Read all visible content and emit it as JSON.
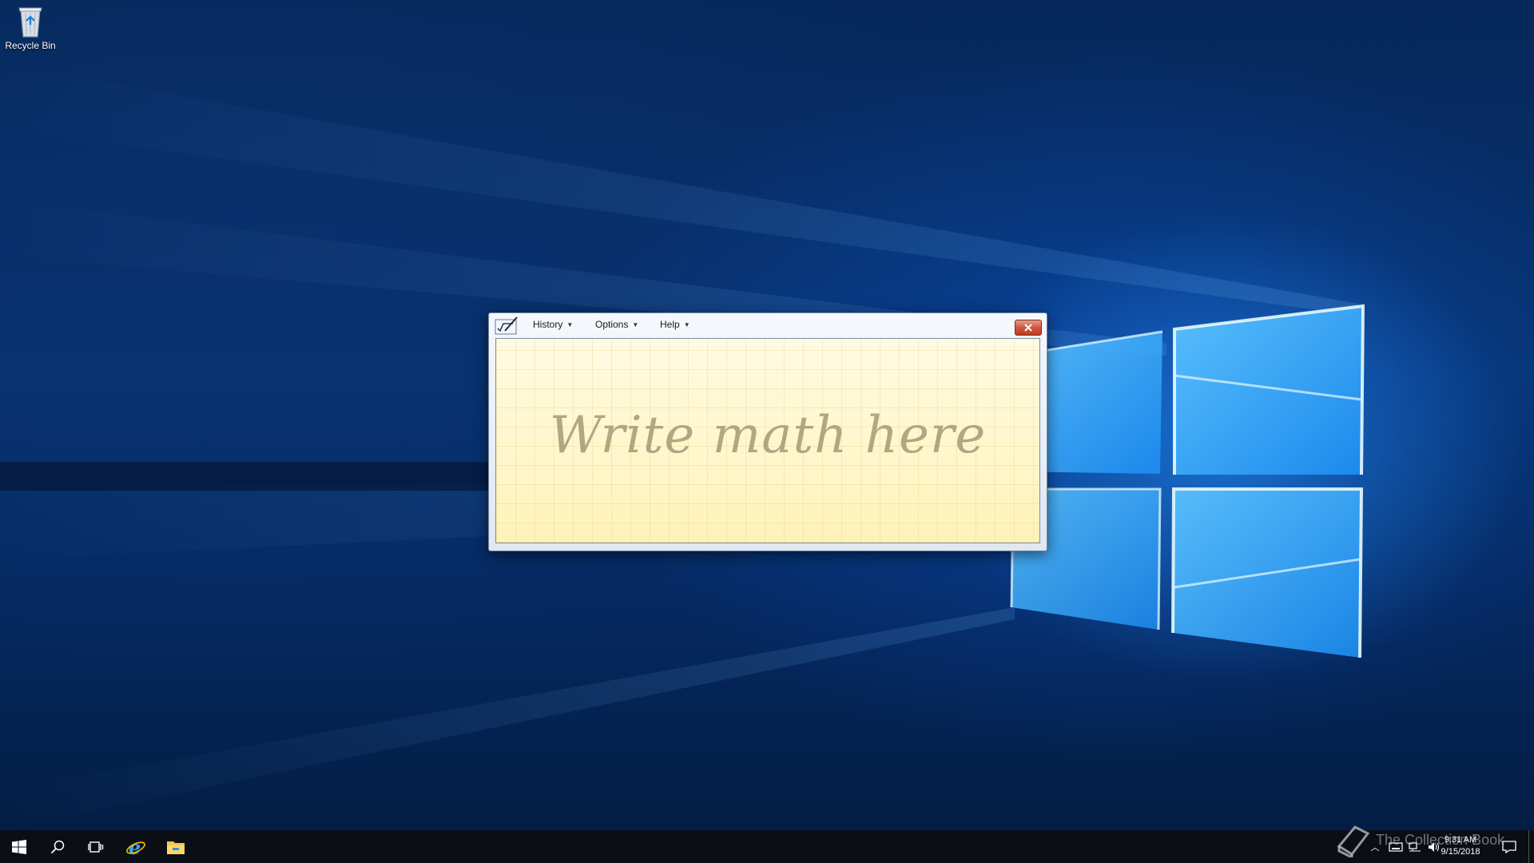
{
  "desktop": {
    "icons": [
      {
        "label": "Recycle Bin",
        "icon": "recycle-bin-icon"
      }
    ]
  },
  "window": {
    "app_icon": "math-input-panel-icon",
    "menus": [
      {
        "label": "History"
      },
      {
        "label": "Options"
      },
      {
        "label": "Help"
      }
    ],
    "close_icon": "close-icon",
    "writing_area_hint": "Write math here"
  },
  "taskbar": {
    "buttons": [
      {
        "icon": "windows-start-icon"
      },
      {
        "icon": "search-icon"
      },
      {
        "icon": "task-view-icon"
      },
      {
        "icon": "internet-explorer-icon"
      },
      {
        "icon": "file-explorer-icon"
      }
    ],
    "watermark": "The Collection Book",
    "tray_icons": [
      "show-hidden-icons-chevron-icon",
      "keyboard-icon",
      "network-icon",
      "volume-icon"
    ],
    "clock": {
      "time": "9:31 AM",
      "date": "9/15/2018"
    },
    "notifications_icon": "action-center-icon"
  },
  "colors": {
    "accent": "#0a5cc4",
    "close_button": "#c9452b",
    "writing_area": "#fff4c2"
  }
}
